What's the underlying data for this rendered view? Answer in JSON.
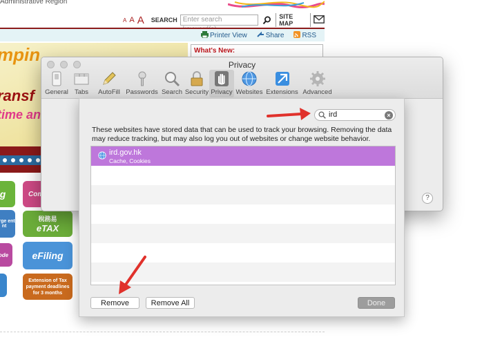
{
  "background_site": {
    "region_text": "Administrative Region",
    "font_size_letters": [
      "A",
      "A",
      "A"
    ],
    "search_label": "SEARCH",
    "search_placeholder": "Enter search keyword(s)",
    "site_map": "SITE MAP",
    "printer_view": "Printer View",
    "share": "Share",
    "rss": "RSS",
    "whats_new": "What's New:",
    "banner_line1": "mpin",
    "banner_line2": "ransf",
    "banner_line3": "time an",
    "tile_com": "Com",
    "tile_charge": "harge ent nt",
    "tile_etax_chinese": "稅務易",
    "tile_etax": "eTAX",
    "tile_efiling": "eFiling",
    "tile_extension": "Extension of Tax payment deadlines for 3 months"
  },
  "window": {
    "title": "Privacy",
    "toolbar": [
      {
        "label": "General",
        "icon": "general-switch-icon"
      },
      {
        "label": "Tabs",
        "icon": "tabs-icon"
      },
      {
        "label": "AutoFill",
        "icon": "pencil-icon"
      },
      {
        "label": "Passwords",
        "icon": "key-icon"
      },
      {
        "label": "Search",
        "icon": "magnifier-icon"
      },
      {
        "label": "Security",
        "icon": "lock-icon"
      },
      {
        "label": "Privacy",
        "icon": "hand-icon"
      },
      {
        "label": "Websites",
        "icon": "globe-icon"
      },
      {
        "label": "Extensions",
        "icon": "puzzle-icon"
      },
      {
        "label": "Advanced",
        "icon": "gear-icon"
      }
    ],
    "active_tab": "Privacy",
    "help": "?"
  },
  "sheet": {
    "search_value": "ird",
    "description": "These websites have stored data that can be used to track your browsing. Removing the data may reduce tracking, but may also log you out of websites or change website behavior.",
    "sites": [
      {
        "name": "ird.gov.hk",
        "detail": "Cache, Cookies"
      }
    ],
    "buttons": {
      "remove": "Remove",
      "remove_all": "Remove All",
      "done": "Done"
    }
  },
  "colors": {
    "selection": "#be77db",
    "annotation_arrow": "#e0312b",
    "site_maroon": "#8b1a1a"
  }
}
